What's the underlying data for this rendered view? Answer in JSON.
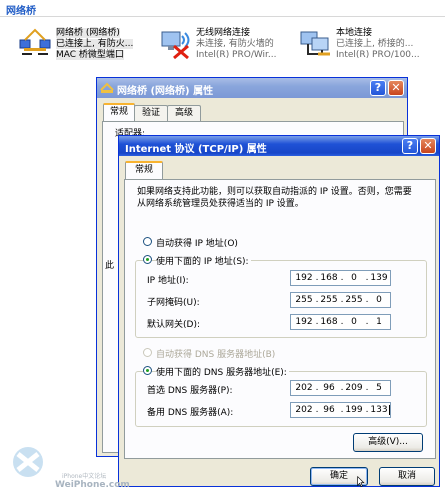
{
  "folder": {
    "title": "网络桥"
  },
  "connections": [
    {
      "name": "网络桥 (网络桥)",
      "status": "已连接上, 有防火...",
      "device": "MAC 桥微型端口"
    },
    {
      "name": "无线网络连接",
      "status": "未连接, 有防火墙的",
      "device": "Intel(R) PRO/Wir..."
    },
    {
      "name": "本地连接",
      "status": "已连接上, 桥接的...",
      "device": "Intel(R) PRO/100..."
    }
  ],
  "bridge_window": {
    "title": "网络桥 (网络桥) 属性",
    "tabs": [
      "常规",
      "验证",
      "高级"
    ],
    "partial_label": "适配器:",
    "partial_char": "此"
  },
  "tcpip_window": {
    "title": "Internet 协议 (TCP/IP) 属性",
    "tab": "常规",
    "description": "如果网络支持此功能，则可以获取自动指派的 IP 设置。否则，您需要从网络系统管理员处获得适当的 IP 设置。",
    "ip_auto_label": "自动获得 IP 地址(O)",
    "ip_manual_label": "使用下面的 IP 地址(S):",
    "fields": [
      {
        "label": "IP 地址(I):",
        "value": [
          "192",
          "168",
          "0",
          "139"
        ]
      },
      {
        "label": "子网掩码(U):",
        "value": [
          "255",
          "255",
          "255",
          "0"
        ]
      },
      {
        "label": "默认网关(D):",
        "value": [
          "192",
          "168",
          "0",
          "1"
        ]
      }
    ],
    "dns_auto_label": "自动获得 DNS 服务器地址(B)",
    "dns_manual_label": "使用下面的 DNS 服务器地址(E):",
    "dns_fields": [
      {
        "label": "首选 DNS 服务器(P):",
        "value": [
          "202",
          "96",
          "209",
          "5"
        ]
      },
      {
        "label": "备用 DNS 服务器(A):",
        "value": [
          "202",
          "96",
          "199",
          "133"
        ]
      }
    ],
    "advanced_label": "高级(V)...",
    "ok_label": "确定",
    "cancel_label": "取消"
  },
  "watermark": {
    "line1": "iPhone中文论坛",
    "line2": "WeiPhone.com"
  },
  "colors": {
    "title_active": "#1f52d6",
    "title_inactive": "#8aa6dc",
    "dialog_bg": "#ece9d8",
    "radio_dot": "#21a121"
  }
}
